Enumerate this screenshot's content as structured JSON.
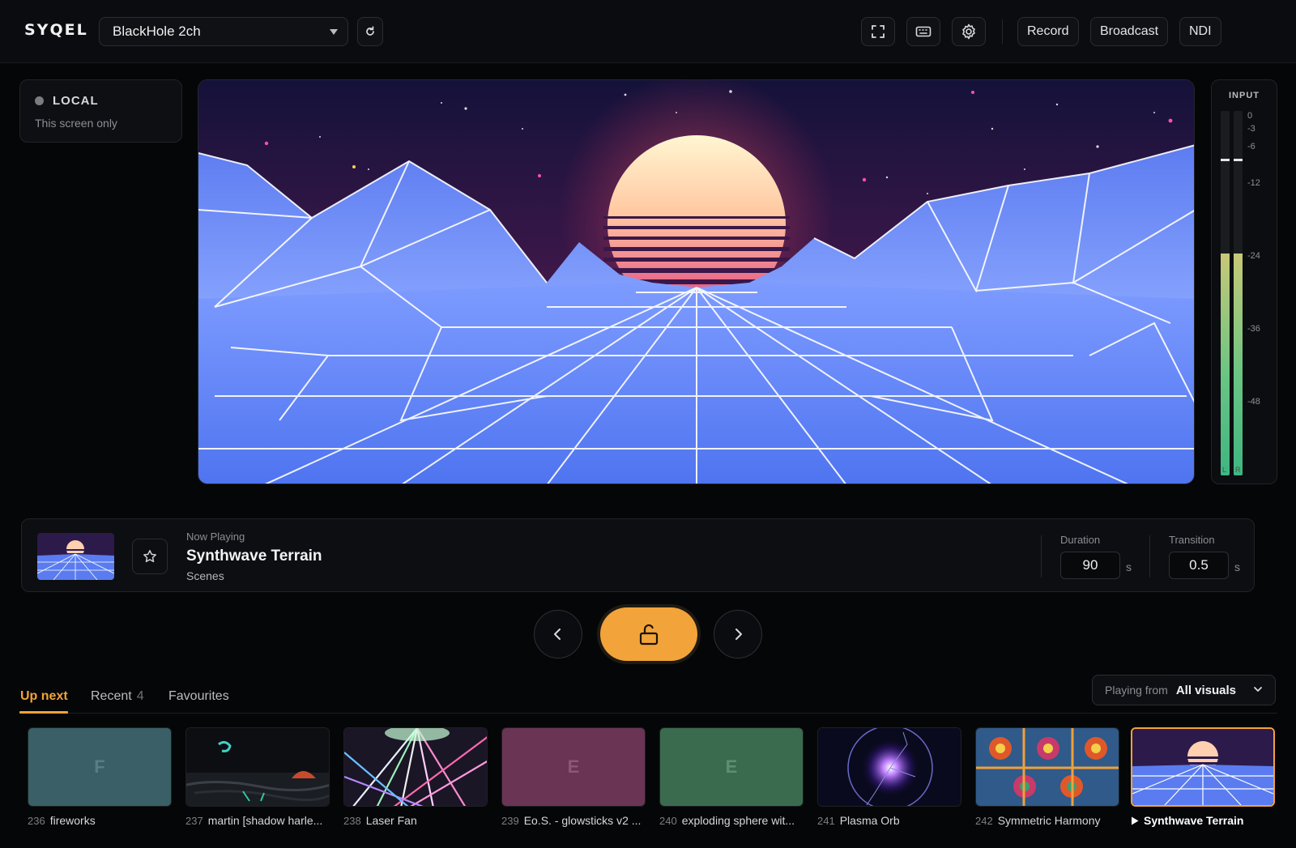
{
  "header": {
    "logo": "SYQEL",
    "device": "BlackHole 2ch",
    "buttons": {
      "record": "Record",
      "broadcast": "Broadcast",
      "ndi": "NDI"
    }
  },
  "local": {
    "title": "LOCAL",
    "subtitle": "This screen only"
  },
  "meter": {
    "title": "INPUT",
    "ticks": [
      "0",
      "-3",
      "-6",
      "-12",
      "-24",
      "-36",
      "-48"
    ],
    "left_level": 0.61,
    "right_level": 0.61,
    "left_label": "L",
    "right_label": "R"
  },
  "now_playing": {
    "label": "Now Playing",
    "title": "Synthwave Terrain",
    "category": "Scenes",
    "duration_label": "Duration",
    "duration_value": "90",
    "duration_unit": "s",
    "transition_label": "Transition",
    "transition_value": "0.5",
    "transition_unit": "s"
  },
  "tabs": {
    "up_next": "Up next",
    "recent": "Recent",
    "recent_count": "4",
    "favourites": "Favourites"
  },
  "source": {
    "label": "Playing from",
    "value": "All visuals"
  },
  "queue": [
    {
      "num": "236",
      "name": "fireworks",
      "letter": "F",
      "color": "#3a5f66"
    },
    {
      "num": "237",
      "name": "martin [shadow harle...",
      "letter": "",
      "color": "#101215"
    },
    {
      "num": "238",
      "name": "Laser Fan",
      "letter": "",
      "color": "#f0eef0"
    },
    {
      "num": "239",
      "name": "Eo.S. - glowsticks v2 ...",
      "letter": "E",
      "color": "#6a3454"
    },
    {
      "num": "240",
      "name": "exploding sphere wit...",
      "letter": "E",
      "color": "#3a6b4e"
    },
    {
      "num": "241",
      "name": "Plasma Orb",
      "letter": "",
      "color": "#0a0a20"
    },
    {
      "num": "242",
      "name": "Symmetric Harmony",
      "letter": "",
      "color": "#2f5a8a"
    },
    {
      "num": "",
      "name": "Synthwave Terrain",
      "letter": "",
      "color": "#3a5bd8",
      "active": true
    }
  ],
  "colors": {
    "accent": "#f2a33a",
    "background": "#050607"
  }
}
